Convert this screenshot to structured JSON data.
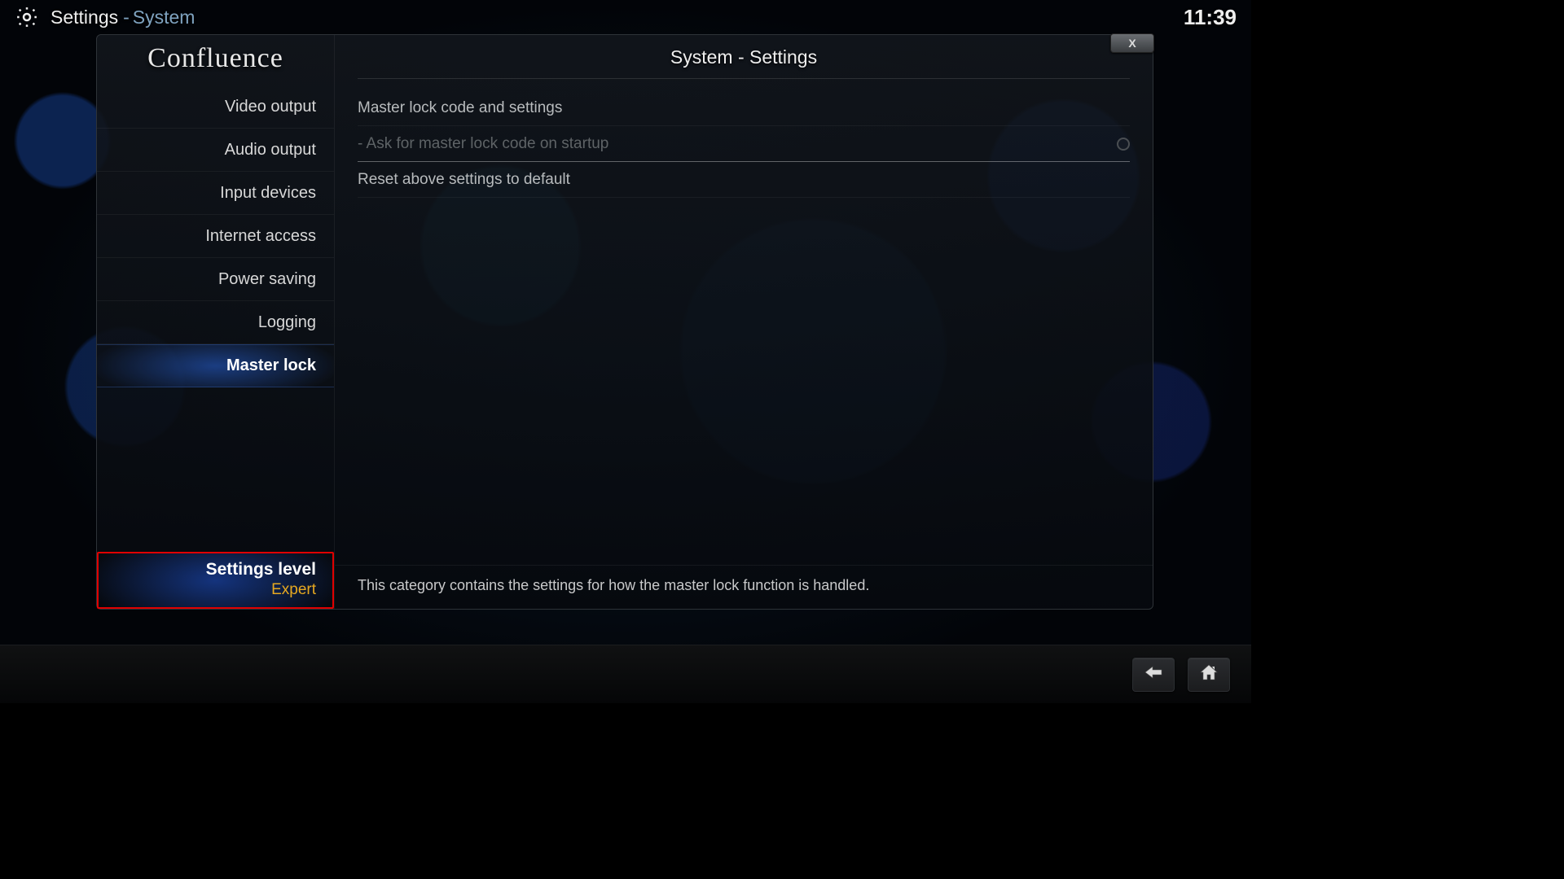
{
  "topbar": {
    "breadcrumb_main": "Settings",
    "breadcrumb_separator": "-",
    "breadcrumb_sub": "System",
    "clock": "11:39"
  },
  "window": {
    "logo_text": "Confluence",
    "pane_title": "System - Settings",
    "close_label": "X"
  },
  "sidebar": {
    "items": [
      {
        "label": "Video output"
      },
      {
        "label": "Audio output"
      },
      {
        "label": "Input devices"
      },
      {
        "label": "Internet access"
      },
      {
        "label": "Power saving"
      },
      {
        "label": "Logging"
      },
      {
        "label": "Master lock"
      }
    ],
    "selected_index": 6,
    "settings_level": {
      "title": "Settings level",
      "value": "Expert"
    }
  },
  "content": {
    "rows": [
      {
        "label": "Master lock code and settings",
        "disabled": false,
        "indent": false,
        "has_toggle": false
      },
      {
        "label": "Ask for master lock code on startup",
        "disabled": true,
        "indent": true,
        "has_toggle": true
      },
      {
        "label": "Reset above settings to default",
        "disabled": false,
        "indent": false,
        "has_toggle": false
      }
    ],
    "description": "This category contains the settings for how the master lock function is handled."
  }
}
